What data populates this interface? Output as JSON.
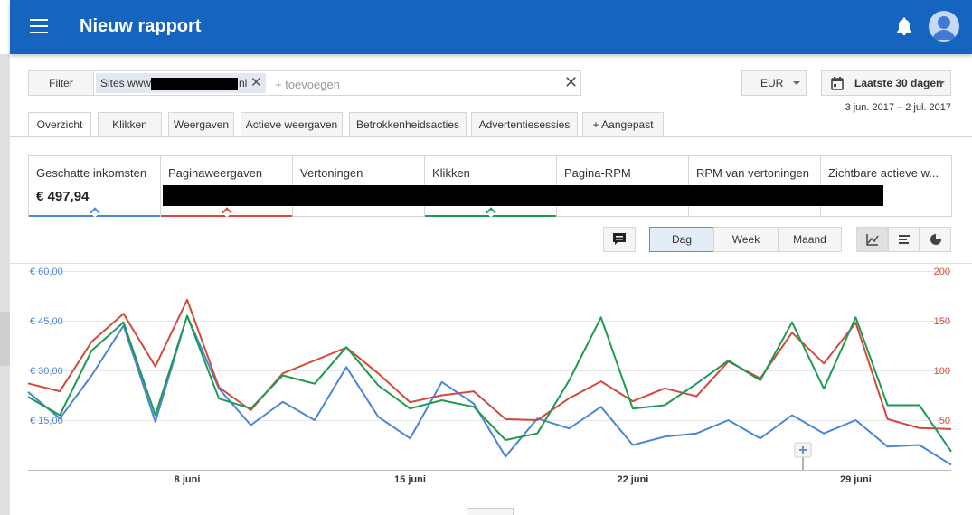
{
  "appbar": {
    "title": "Nieuw rapport"
  },
  "filter": {
    "button_label": "Filter",
    "chip_prefix": "Sites www.",
    "chip_suffix": "nl",
    "chip_remove": "✕",
    "add_placeholder": "+ toevoegen",
    "clear": "✕"
  },
  "currency": {
    "label": "EUR"
  },
  "daterange": {
    "label": "Laatste 30 dagen",
    "range_text": "3 jun. 2017 – 2 jul. 2017"
  },
  "tabs": [
    {
      "label": "Overzicht"
    },
    {
      "label": "Klikken"
    },
    {
      "label": "Weergaven"
    },
    {
      "label": "Actieve weergaven"
    },
    {
      "label": "Betrokkenheidsacties"
    },
    {
      "label": "Advertentiesessies"
    },
    {
      "label": "Aangepast"
    }
  ],
  "metrics": [
    {
      "label": "Geschatte inkomsten",
      "value": "€ 497,94"
    },
    {
      "label": "Paginaweergaven"
    },
    {
      "label": "Vertoningen"
    },
    {
      "label": "Klikken"
    },
    {
      "label": "Pagina-RPM"
    },
    {
      "label": "RPM van vertoningen"
    },
    {
      "label": "Zichtbare actieve w..."
    }
  ],
  "granularity": {
    "day": "Dag",
    "week": "Week",
    "month": "Maand",
    "selected": "Dag"
  },
  "colors": {
    "blue": "#4a86d8",
    "red": "#d14a3b",
    "green": "#1e9a52",
    "appbar": "#1565c0"
  },
  "chart_data": {
    "type": "line",
    "x_labels": [
      "8 juni",
      "15 juni",
      "22 juni",
      "29 juni"
    ],
    "x_label_index": [
      5,
      12,
      19,
      26
    ],
    "y_left_ticks": [
      "€ 15,00",
      "€ 30,00",
      "€ 45,00",
      "€ 60,00"
    ],
    "y_left_range": [
      0,
      60
    ],
    "y_right_ticks": [
      "50",
      "100",
      "150",
      "200"
    ],
    "y_right_range": [
      0,
      200
    ],
    "grid": true,
    "series": [
      {
        "color": "#4a86d8",
        "axis": "left",
        "values": [
          23.5,
          15.5,
          28.5,
          43.5,
          14.5,
          46.5,
          24.5,
          13.5,
          20.5,
          15,
          31,
          16,
          9.5,
          26.5,
          20,
          4,
          15.5,
          12.5,
          19,
          7.5,
          10,
          11,
          15,
          9.5,
          16.5,
          11,
          15,
          7,
          7.5,
          1.5
        ]
      },
      {
        "color": "#d14a3b",
        "axis": "right",
        "values": [
          87,
          79,
          129,
          157,
          104,
          171,
          83,
          60,
          97,
          110,
          123,
          97,
          68,
          75,
          79,
          51,
          50,
          72,
          89,
          69,
          82,
          74,
          109,
          92,
          138,
          107,
          148,
          51,
          42,
          41
        ]
      },
      {
        "color": "#1e9a52",
        "axis": "left",
        "values": [
          22,
          16.5,
          36,
          44.5,
          16.5,
          46.5,
          21.5,
          18.5,
          28.5,
          26,
          37,
          25.5,
          18.5,
          21,
          19,
          9,
          11,
          27,
          46,
          18.5,
          19.5,
          26,
          33,
          27,
          44.5,
          24.5,
          46,
          19.5,
          19.5,
          5.5
        ]
      }
    ]
  }
}
